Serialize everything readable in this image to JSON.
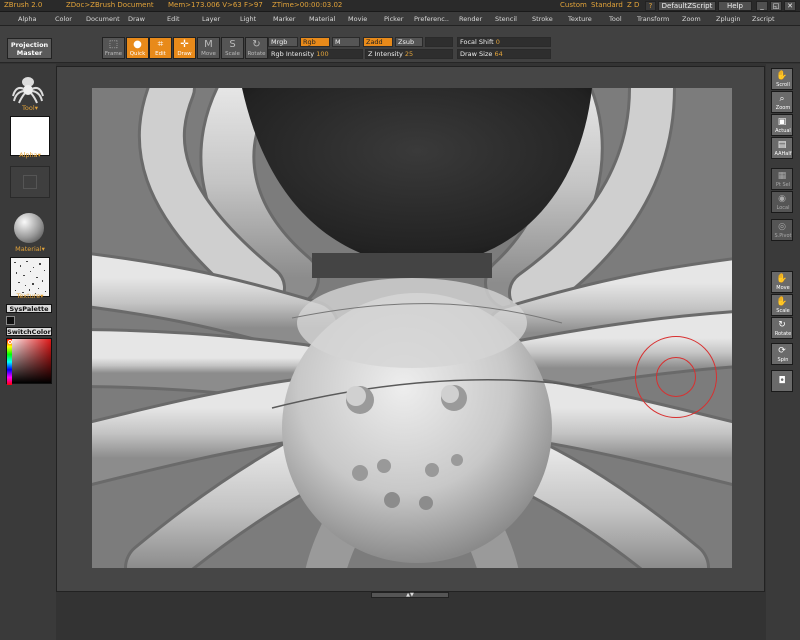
{
  "titlebar": {
    "app": "ZBrush 2.0",
    "doc": "ZDoc>ZBrush Document",
    "mem": "Mem>173.006  V>63  F>97",
    "ztime": "ZTime>00:00:03.02",
    "custom": "Custom",
    "standard": "Standard",
    "zd": "Z D",
    "help_q": "?",
    "script": "DefaultZScript",
    "help": "Help",
    "win_buttons": [
      "_",
      "◱",
      "✕"
    ]
  },
  "menu": [
    "Alpha",
    "Color",
    "Document",
    "Draw",
    "Edit",
    "Layer",
    "Light",
    "Marker",
    "Material",
    "Movie",
    "Picker",
    "Preferenc..",
    "Render",
    "Stencil",
    "Stroke",
    "Texture",
    "Tool",
    "Transform",
    "Zoom",
    "Zplugin",
    "Zscript"
  ],
  "toolbar": {
    "projection_master": "Projection Master",
    "frame": "Frame",
    "quick": "Quick",
    "edit": "Edit",
    "draw": "Draw",
    "move": "Move",
    "scale": "Scale",
    "rotate": "Rotate",
    "mrgb": "Mrgb",
    "rgb": "Rgb",
    "m": "M",
    "zadd": "Zadd",
    "zsub": "Zsub",
    "rgb_intensity_label": "Rgb Intensity",
    "rgb_intensity_value": "100",
    "z_intensity_label": "Z Intensity",
    "z_intensity_value": "25",
    "focal_shift_label": "Focal Shift",
    "focal_shift_value": "0",
    "draw_size_label": "Draw Size",
    "draw_size_value": "64"
  },
  "leftpanel": {
    "tool": "Tool",
    "alpha": "Alpha",
    "material": "Material",
    "texture": "Texture",
    "syspalette": "SysPalette",
    "switchcolor": "SwitchColor"
  },
  "rightshelf": [
    "Scroll",
    "Zoom",
    "Actual",
    "AAHalf",
    "Pt Sel",
    "Local",
    "S.Pivot",
    "Move",
    "Scale",
    "Rotate",
    "Spin",
    ""
  ],
  "colors": {
    "accent": "#e88a1a",
    "brush_cursor": "#d83030"
  }
}
